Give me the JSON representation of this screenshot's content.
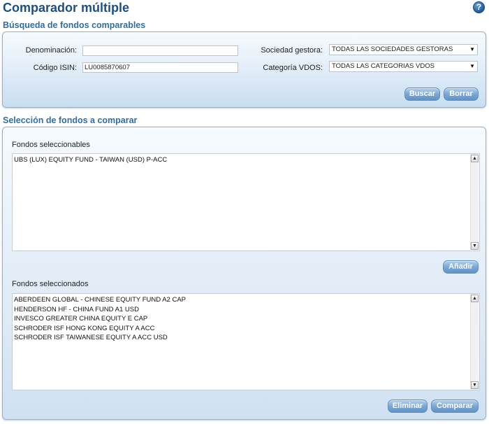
{
  "header": {
    "title": "Comparador múltiple",
    "help_icon": "?"
  },
  "search": {
    "section_title": "Búsqueda de fondos comparables",
    "denominacion_label": "Denominación:",
    "denominacion_value": "",
    "isin_label": "Código ISIN:",
    "isin_value": "LU0085870607",
    "gestora_label": "Sociedad gestora:",
    "gestora_value": "TODAS LAS SOCIEDADES GESTORAS",
    "categoria_label": "Categoría VDOS:",
    "categoria_value": "TODAS LAS CATEGORIAS VDOS",
    "buscar_label": "Buscar",
    "borrar_label": "Borrar"
  },
  "selection": {
    "section_title": "Selección de fondos a comparar",
    "selectable_label": "Fondos seleccionables",
    "selectable_items": [
      "UBS (LUX) EQUITY FUND - TAIWAN (USD) P-ACC"
    ],
    "add_label": "Añadir",
    "selected_label": "Fondos seleccionados",
    "selected_items": [
      "ABERDEEN GLOBAL - CHINESE EQUITY FUND A2 CAP",
      "HENDERSON HF - CHINA FUND A1 USD",
      "INVESCO GREATER CHINA EQUITY E CAP",
      "SCHRODER ISF HONG KONG EQUITY A ACC",
      "SCHRODER ISF TAIWANESE EQUITY A ACC USD"
    ],
    "remove_label": "Eliminar",
    "compare_label": "Comparar"
  },
  "icons": {
    "scroll_up": "▲",
    "scroll_down": "▼",
    "dropdown": "▼"
  },
  "colors": {
    "title": "#1b4f86",
    "section_title": "#2e6fa8",
    "button": "#6a9bcd"
  }
}
